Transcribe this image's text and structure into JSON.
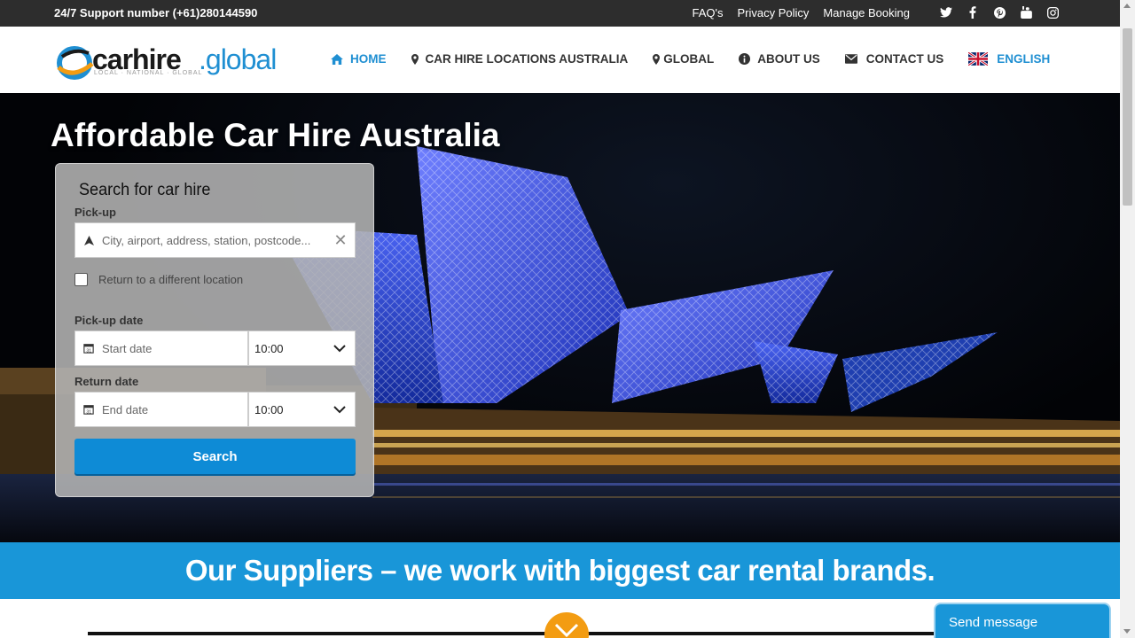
{
  "topbar": {
    "support": "24/7 Support number (+61)280144590",
    "links": [
      "FAQ's",
      "Privacy Policy",
      "Manage Booking"
    ],
    "social_icons": [
      "twitter-icon",
      "facebook-icon",
      "pinterest-icon",
      "youtube-icon",
      "instagram-icon"
    ]
  },
  "logo": {
    "part1": "carhire",
    "part2": ".global",
    "tagline": "LOCAL · NATIONAL · GLOBAL"
  },
  "nav": {
    "home": "HOME",
    "locations": "CAR HIRE LOCATIONS AUSTRALIA",
    "global": "GLOBAL",
    "about": "ABOUT US",
    "contact": "CONTACT US",
    "language": "ENGLISH"
  },
  "hero": {
    "title": "Affordable Car Hire Australia"
  },
  "search": {
    "title": "Search for car hire",
    "pickup_label": "Pick-up",
    "pickup_placeholder": "City, airport, address, station, postcode...",
    "return_different": "Return to a different location",
    "pickup_date_label": "Pick-up date",
    "start_placeholder": "Start date",
    "start_time": "10:00",
    "return_date_label": "Return date",
    "end_placeholder": "End date",
    "end_time": "10:00",
    "button": "Search"
  },
  "banner": {
    "text": "Our Suppliers – we work with biggest car rental brands."
  },
  "chat": {
    "label": "Send message"
  },
  "colors": {
    "accent": "#1996d8",
    "button": "#0e8bd6",
    "topbar": "#2d2d2d",
    "orange": "#f39c12"
  }
}
